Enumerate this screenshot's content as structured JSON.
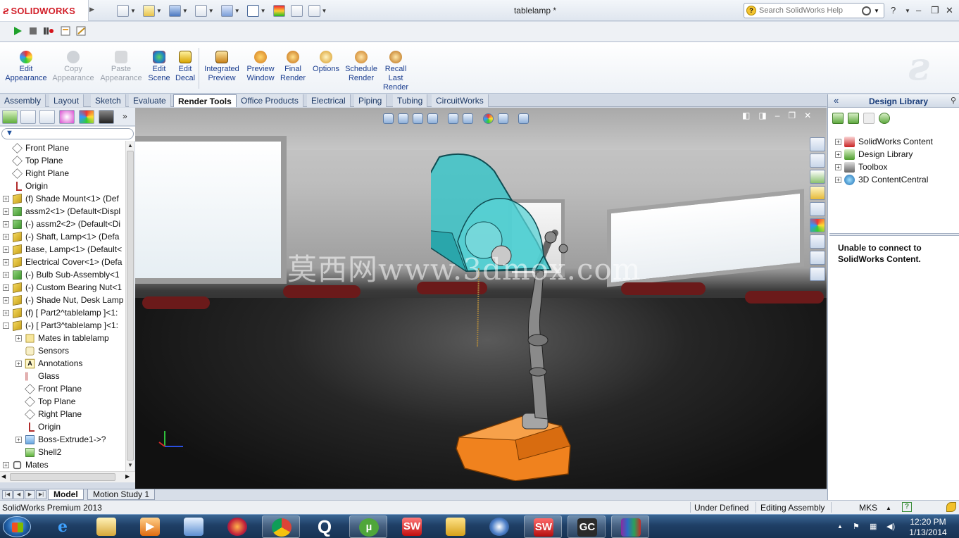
{
  "app": {
    "logo_text": "SOLIDWORKS",
    "document_title": "tablelamp *"
  },
  "search": {
    "placeholder": "Search SolidWorks Help"
  },
  "ribbon": {
    "buttons": [
      {
        "label": "Edit\nAppearance",
        "enabled": true
      },
      {
        "label": "Copy\nAppearance",
        "enabled": false
      },
      {
        "label": "Paste\nAppearance",
        "enabled": false
      },
      {
        "label": "Edit\nScene",
        "enabled": true
      },
      {
        "label": "Edit\nDecal",
        "enabled": true
      },
      {
        "label": "Integrated\nPreview",
        "enabled": true
      },
      {
        "label": "Preview\nWindow",
        "enabled": true
      },
      {
        "label": "Final\nRender",
        "enabled": true
      },
      {
        "label": "Options",
        "enabled": true
      },
      {
        "label": "Schedule\nRender",
        "enabled": true
      },
      {
        "label": "Recall\nLast\nRender",
        "enabled": true
      }
    ]
  },
  "tabs": [
    "Assembly",
    "Layout",
    "Sketch",
    "Evaluate",
    "Render Tools",
    "Office Products",
    "Electrical",
    "Piping",
    "Tubing",
    "CircuitWorks"
  ],
  "active_tab": "Render Tools",
  "tree": [
    {
      "label": "Front Plane",
      "icon": "plane",
      "indent": 0,
      "expander": false
    },
    {
      "label": "Top Plane",
      "icon": "plane",
      "indent": 0,
      "expander": false
    },
    {
      "label": "Right Plane",
      "icon": "plane",
      "indent": 0,
      "expander": false
    },
    {
      "label": "Origin",
      "icon": "origin",
      "indent": 0,
      "expander": false
    },
    {
      "label": "(f) Shade Mount<1> (Def",
      "icon": "part",
      "indent": 0,
      "expander": "+"
    },
    {
      "label": "assm2<1> (Default<Displ",
      "icon": "sub",
      "indent": 0,
      "expander": "+"
    },
    {
      "label": "(-) assm2<2> (Default<Di",
      "icon": "sub",
      "indent": 0,
      "expander": "+"
    },
    {
      "label": "(-) Shaft, Lamp<1> (Defa",
      "icon": "part",
      "indent": 0,
      "expander": "+"
    },
    {
      "label": "Base, Lamp<1> (Default<",
      "icon": "part",
      "indent": 0,
      "expander": "+"
    },
    {
      "label": "Electrical Cover<1> (Defa",
      "icon": "part",
      "indent": 0,
      "expander": "+"
    },
    {
      "label": "(-) Bulb Sub-Assembly<1",
      "icon": "sub",
      "indent": 0,
      "expander": "+"
    },
    {
      "label": "(-) Custom Bearing Nut<1",
      "icon": "part",
      "indent": 0,
      "expander": "+"
    },
    {
      "label": "(-) Shade Nut, Desk Lamp",
      "icon": "part",
      "indent": 0,
      "expander": "+"
    },
    {
      "label": "(f) [ Part2^tablelamp ]<1:",
      "icon": "part",
      "indent": 0,
      "expander": "+"
    },
    {
      "label": "(-) [ Part3^tablelamp ]<1:",
      "icon": "part",
      "indent": 0,
      "expander": "-"
    },
    {
      "label": "Mates in tablelamp",
      "icon": "mates",
      "indent": 1,
      "expander": "+"
    },
    {
      "label": "Sensors",
      "icon": "sensor",
      "indent": 1,
      "expander": false
    },
    {
      "label": "Annotations",
      "icon": "annot",
      "indent": 1,
      "expander": "+"
    },
    {
      "label": "Glass",
      "icon": "glass",
      "indent": 1,
      "expander": false
    },
    {
      "label": "Front Plane",
      "icon": "plane",
      "indent": 1,
      "expander": false
    },
    {
      "label": "Top Plane",
      "icon": "plane",
      "indent": 1,
      "expander": false
    },
    {
      "label": "Right Plane",
      "icon": "plane",
      "indent": 1,
      "expander": false
    },
    {
      "label": "Origin",
      "icon": "origin",
      "indent": 1,
      "expander": false
    },
    {
      "label": "Boss-Extrude1->?",
      "icon": "boss",
      "indent": 1,
      "expander": "+"
    },
    {
      "label": "Shell2",
      "icon": "shell",
      "indent": 1,
      "expander": false
    },
    {
      "label": "Mates",
      "icon": "matesgrp",
      "indent": 0,
      "expander": "+"
    }
  ],
  "viewport": {
    "watermark": "莫西网www.3dmox.com"
  },
  "design_library": {
    "title": "Design Library",
    "items": [
      "SolidWorks Content",
      "Design Library",
      "Toolbox",
      "3D ContentCentral"
    ],
    "message": "Unable to connect to SolidWorks Content."
  },
  "model_tabs": [
    "Model",
    "Motion Study 1"
  ],
  "status": {
    "product": "SolidWorks Premium 2013",
    "definition": "Under Defined",
    "mode": "Editing Assembly",
    "units": "MKS"
  },
  "taskbar": {
    "apps": [
      "internet-explorer",
      "file-explorer",
      "media-player",
      "notepad",
      "photo-viewer",
      "chrome",
      "quicktime",
      "utorrent",
      "solidworks-explorer",
      "keyshot-bangalore",
      "app-blue",
      "solidworks",
      "gc",
      "winrar"
    ],
    "time": "12:20 PM",
    "date": "1/13/2014"
  },
  "colors": {
    "brand_red": "#d2202a",
    "shade_teal": "#3cc4c8",
    "base_orange": "#f0821e",
    "ribbon_text": "#1a3d8f"
  }
}
